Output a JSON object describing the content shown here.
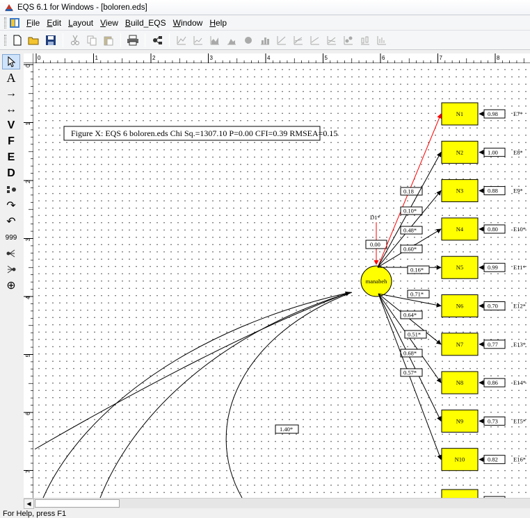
{
  "window": {
    "title": "EQS 6.1 for Windows - [boloren.eds]"
  },
  "menu": {
    "items": [
      {
        "key": "F",
        "rest": "ile"
      },
      {
        "key": "E",
        "rest": "dit"
      },
      {
        "key": "L",
        "rest": "ayout"
      },
      {
        "key": "V",
        "rest": "iew"
      },
      {
        "key": "B",
        "rest": "uild_EQS"
      },
      {
        "key": "W",
        "rest": "indow"
      },
      {
        "key": "H",
        "rest": "elp"
      }
    ]
  },
  "toolbar": {
    "icons": [
      "new-icon",
      "open-icon",
      "save-icon",
      "cut-icon",
      "copy-icon",
      "paste-icon",
      "print-icon",
      "diagram-icon",
      "chart-icon",
      "line-chart-icon",
      "area-chart-icon",
      "mountain-chart-icon",
      "pie-chart-icon",
      "bar-chart-icon",
      "line-chart-2-icon",
      "line-chart-3-icon",
      "line-chart-4-icon",
      "line-chart-5-icon",
      "scatter-chart-icon",
      "boxplot-icon",
      "table-chart-icon"
    ]
  },
  "left_tools": [
    "pointer",
    "A",
    "→",
    "↔",
    "V",
    "F",
    "E",
    "D",
    "⚭",
    "↷",
    "↶",
    "999",
    "⚲",
    "⚲",
    "⊕"
  ],
  "ruler": {
    "h_labels": [
      "0",
      "1",
      "2",
      "3",
      "4",
      "5",
      "6",
      "7",
      "8"
    ],
    "v_labels": [
      "0",
      "1",
      "2",
      "3",
      "4",
      "5",
      "6",
      "7"
    ]
  },
  "diagram": {
    "figure_title": "Figure X: EQS 6 boloren.eds Chi Sq.=1307.10 P=0.00 CFI=0.39 RMSEA=0.15",
    "factor": {
      "name": "manabeh",
      "disturbance": "D1*",
      "disturbance_value": "0.00"
    },
    "indicators": [
      {
        "name": "N1",
        "loading": "0.18",
        "error_value": "0.98",
        "error": "E7*"
      },
      {
        "name": "N2",
        "loading": "0.10*",
        "error_value": "1.00",
        "error": "E8*"
      },
      {
        "name": "N3",
        "loading": "0.48*",
        "error_value": "0.88",
        "error": "E9*"
      },
      {
        "name": "N4",
        "loading": "0.60*",
        "error_value": "0.80",
        "error": "E10*"
      },
      {
        "name": "N5",
        "loading": "0.16*",
        "error_value": "0.99",
        "error": "E11*"
      },
      {
        "name": "N6",
        "loading": "0.71*",
        "error_value": "0.70",
        "error": "E12*"
      },
      {
        "name": "N7",
        "loading": "0.64*",
        "error_value": "0.77",
        "error": "E13*"
      },
      {
        "name": "N8",
        "loading": "0.51*",
        "error_value": "0.86",
        "error": "E14*"
      },
      {
        "name": "N9",
        "loading": "0.68*",
        "error_value": "0.73",
        "error": "E15*"
      },
      {
        "name": "N10",
        "loading": "0.57*",
        "error_value": "0.82",
        "error": "E16*"
      }
    ],
    "covariance_label": "1.40*"
  },
  "status": {
    "text": "For Help, press F1"
  },
  "colors": {
    "box_fill": "#ffff00",
    "factor_fill": "#ffff00",
    "highlight_path": "#ff0000"
  }
}
